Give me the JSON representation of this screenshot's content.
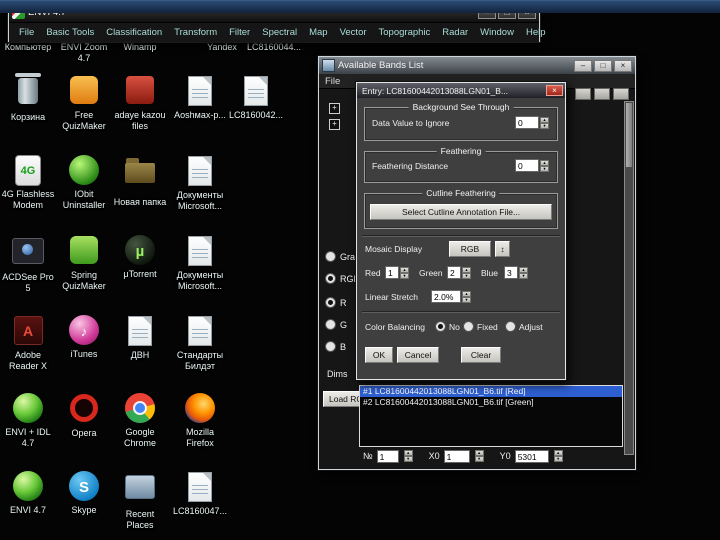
{
  "colors": {
    "selection_blue": "#2e5fd0",
    "close_red": "#c23b2e",
    "desktop_bg": "#040404"
  },
  "envi_window": {
    "title": "ENVI 4.7",
    "menus": [
      "File",
      "Basic Tools",
      "Classification",
      "Transform",
      "Filter",
      "Spectral",
      "Map",
      "Vector",
      "Topographic",
      "Radar",
      "Window",
      "Help"
    ]
  },
  "desktop": {
    "icons": [
      {
        "label": "Компьютер"
      },
      {
        "label": "ENVI Zoom 4.7"
      },
      {
        "label": "Winamp"
      },
      {
        "label": "Yandex"
      },
      {
        "label": "LC8160044..."
      },
      {
        "label": "Корзина"
      },
      {
        "label": "Free QuizMaker"
      },
      {
        "label": "adaye kazou files"
      },
      {
        "label": "Аоshмах-р..."
      },
      {
        "label": "LC8160042..."
      },
      {
        "label": "4G Flashless Modem",
        "glyph": "4G"
      },
      {
        "label": "IObit Uninstaller"
      },
      {
        "label": "Новая папка"
      },
      {
        "label": "Документы Microsoft..."
      },
      {
        "label": "ACDSee Pro 5"
      },
      {
        "label": "Spring QuizMaker"
      },
      {
        "label": "μTorrent",
        "glyph": "µ"
      },
      {
        "label": "Документы Microsoft..."
      },
      {
        "label": "Adobe Reader X",
        "glyph": "A"
      },
      {
        "label": "iTunes",
        "glyph": "♪"
      },
      {
        "label": "ДВН"
      },
      {
        "label": "Стандарты Билдэт"
      },
      {
        "label": "ENVI + IDL 4.7"
      },
      {
        "label": "Opera",
        "glyph": "O"
      },
      {
        "label": "Google Chrome"
      },
      {
        "label": "Mozilla Firefox"
      },
      {
        "label": "ENVI 4.7"
      },
      {
        "label": "Skype",
        "glyph": "S"
      },
      {
        "label": "Recent Places"
      },
      {
        "label": "LC8160047..."
      }
    ]
  },
  "bands_window": {
    "title": "Available Bands List",
    "menu_file": "File",
    "gray_scale_label": "Gray Scale",
    "rgb_color_label": "RGB Color",
    "r_label": "R",
    "g_label": "G",
    "b_label": "B",
    "dims_label": "Dims",
    "load_button": "Load RGB",
    "entries": [
      {
        "text": "#1 LC81600442013088LGN01_B6.tif [Red]"
      },
      {
        "text": "#2 LC81600442013088LGN01_B6.tif [Green]"
      }
    ],
    "position_bar": {
      "num_label": "№",
      "num_value": "1",
      "x0_label": "X0",
      "x0_value": "1",
      "y0_label": "Y0",
      "y0_value": "5301"
    }
  },
  "entry_dialog": {
    "title": "Entry: LC81600442013088LGN01_B...",
    "background_group": {
      "title": "Background See Through",
      "label": "Data Value to Ignore",
      "value": "0"
    },
    "feathering_group": {
      "title": "Feathering",
      "label": "Feathering Distance",
      "value": "0"
    },
    "cutline_group": {
      "title": "Cutline Feathering",
      "button": "Select Cutline Annotation File..."
    },
    "mosaic_display": {
      "label": "Mosaic Display",
      "value": "RGB"
    },
    "band_red": {
      "label": "Red",
      "value": "1"
    },
    "band_green": {
      "label": "Green",
      "value": "2"
    },
    "band_blue": {
      "label": "Blue",
      "value": "3"
    },
    "linear_stretch": {
      "label": "Linear Stretch",
      "value": "2.0%"
    },
    "color_balancing": {
      "label": "Color Balancing",
      "no": "No",
      "fixed": "Fixed",
      "adjust": "Adjust"
    },
    "ok": "OK",
    "cancel": "Cancel",
    "clear": "Clear"
  }
}
